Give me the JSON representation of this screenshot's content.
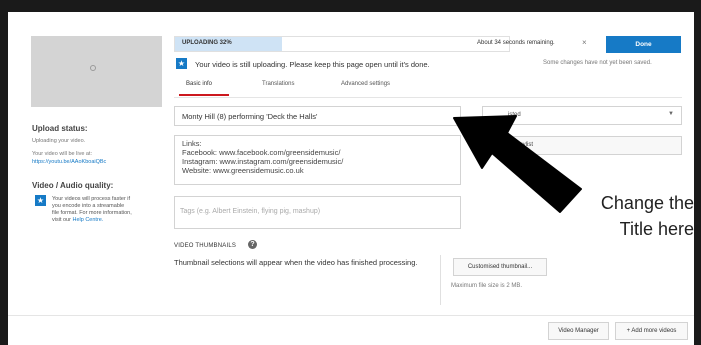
{
  "upload": {
    "status_label": "UPLOADING 32%",
    "progress_fraction": 0.32,
    "remaining": "About 34 seconds remaining.",
    "close_glyph": "×",
    "done_label": "Done",
    "warning": "Your video is still uploading. Please keep this page open until it's done.",
    "unsaved": "Some changes have not yet been saved."
  },
  "tabs": [
    {
      "label": "Basic info",
      "active": true
    },
    {
      "label": "Translations",
      "active": false
    },
    {
      "label": "Advanced settings",
      "active": false
    }
  ],
  "sidebar": {
    "upload_status_title": "Upload status:",
    "uploading_text": "Uploading your video.",
    "live_at": "Your video will be live at:",
    "link": "https://youtu.be/AAoKboaiQBc",
    "quality_title": "Video / Audio quality:",
    "quality_text": "Your videos will process faster if you encode into a streamable file format. For more information, visit our",
    "help_link": "Help Centre."
  },
  "form": {
    "title_value": "Monty Hill (8) performing 'Deck the Halls'",
    "description_lines": [
      "Links:",
      "Facebook:  www.facebook.com/greensidemusic/",
      "Instagram: www.instagram.com/greensidemusic/",
      "Website: www.greensidemusic.co.uk"
    ],
    "tags_placeholder": "Tags (e.g. Albert Einstein, flying pig, mashup)",
    "privacy_value": "isted",
    "playlist_label": "laylist"
  },
  "thumbnails": {
    "title": "VIDEO THUMBNAILS",
    "text": "Thumbnail selections will appear when the video has finished processing.",
    "custom_button": "Customised thumbnail...",
    "max_size": "Maximum file size is 2 MB."
  },
  "footer": {
    "video_manager": "Video Manager",
    "add_more": "+ Add more videos"
  },
  "annotation": {
    "line1": "Change the",
    "line2": "Title here"
  },
  "colors": {
    "accent": "#167ac6",
    "progress": "#cfe3f5",
    "active_tab": "#cc181e"
  },
  "icons": {
    "star": "★",
    "help": "?",
    "caret": "▼"
  }
}
